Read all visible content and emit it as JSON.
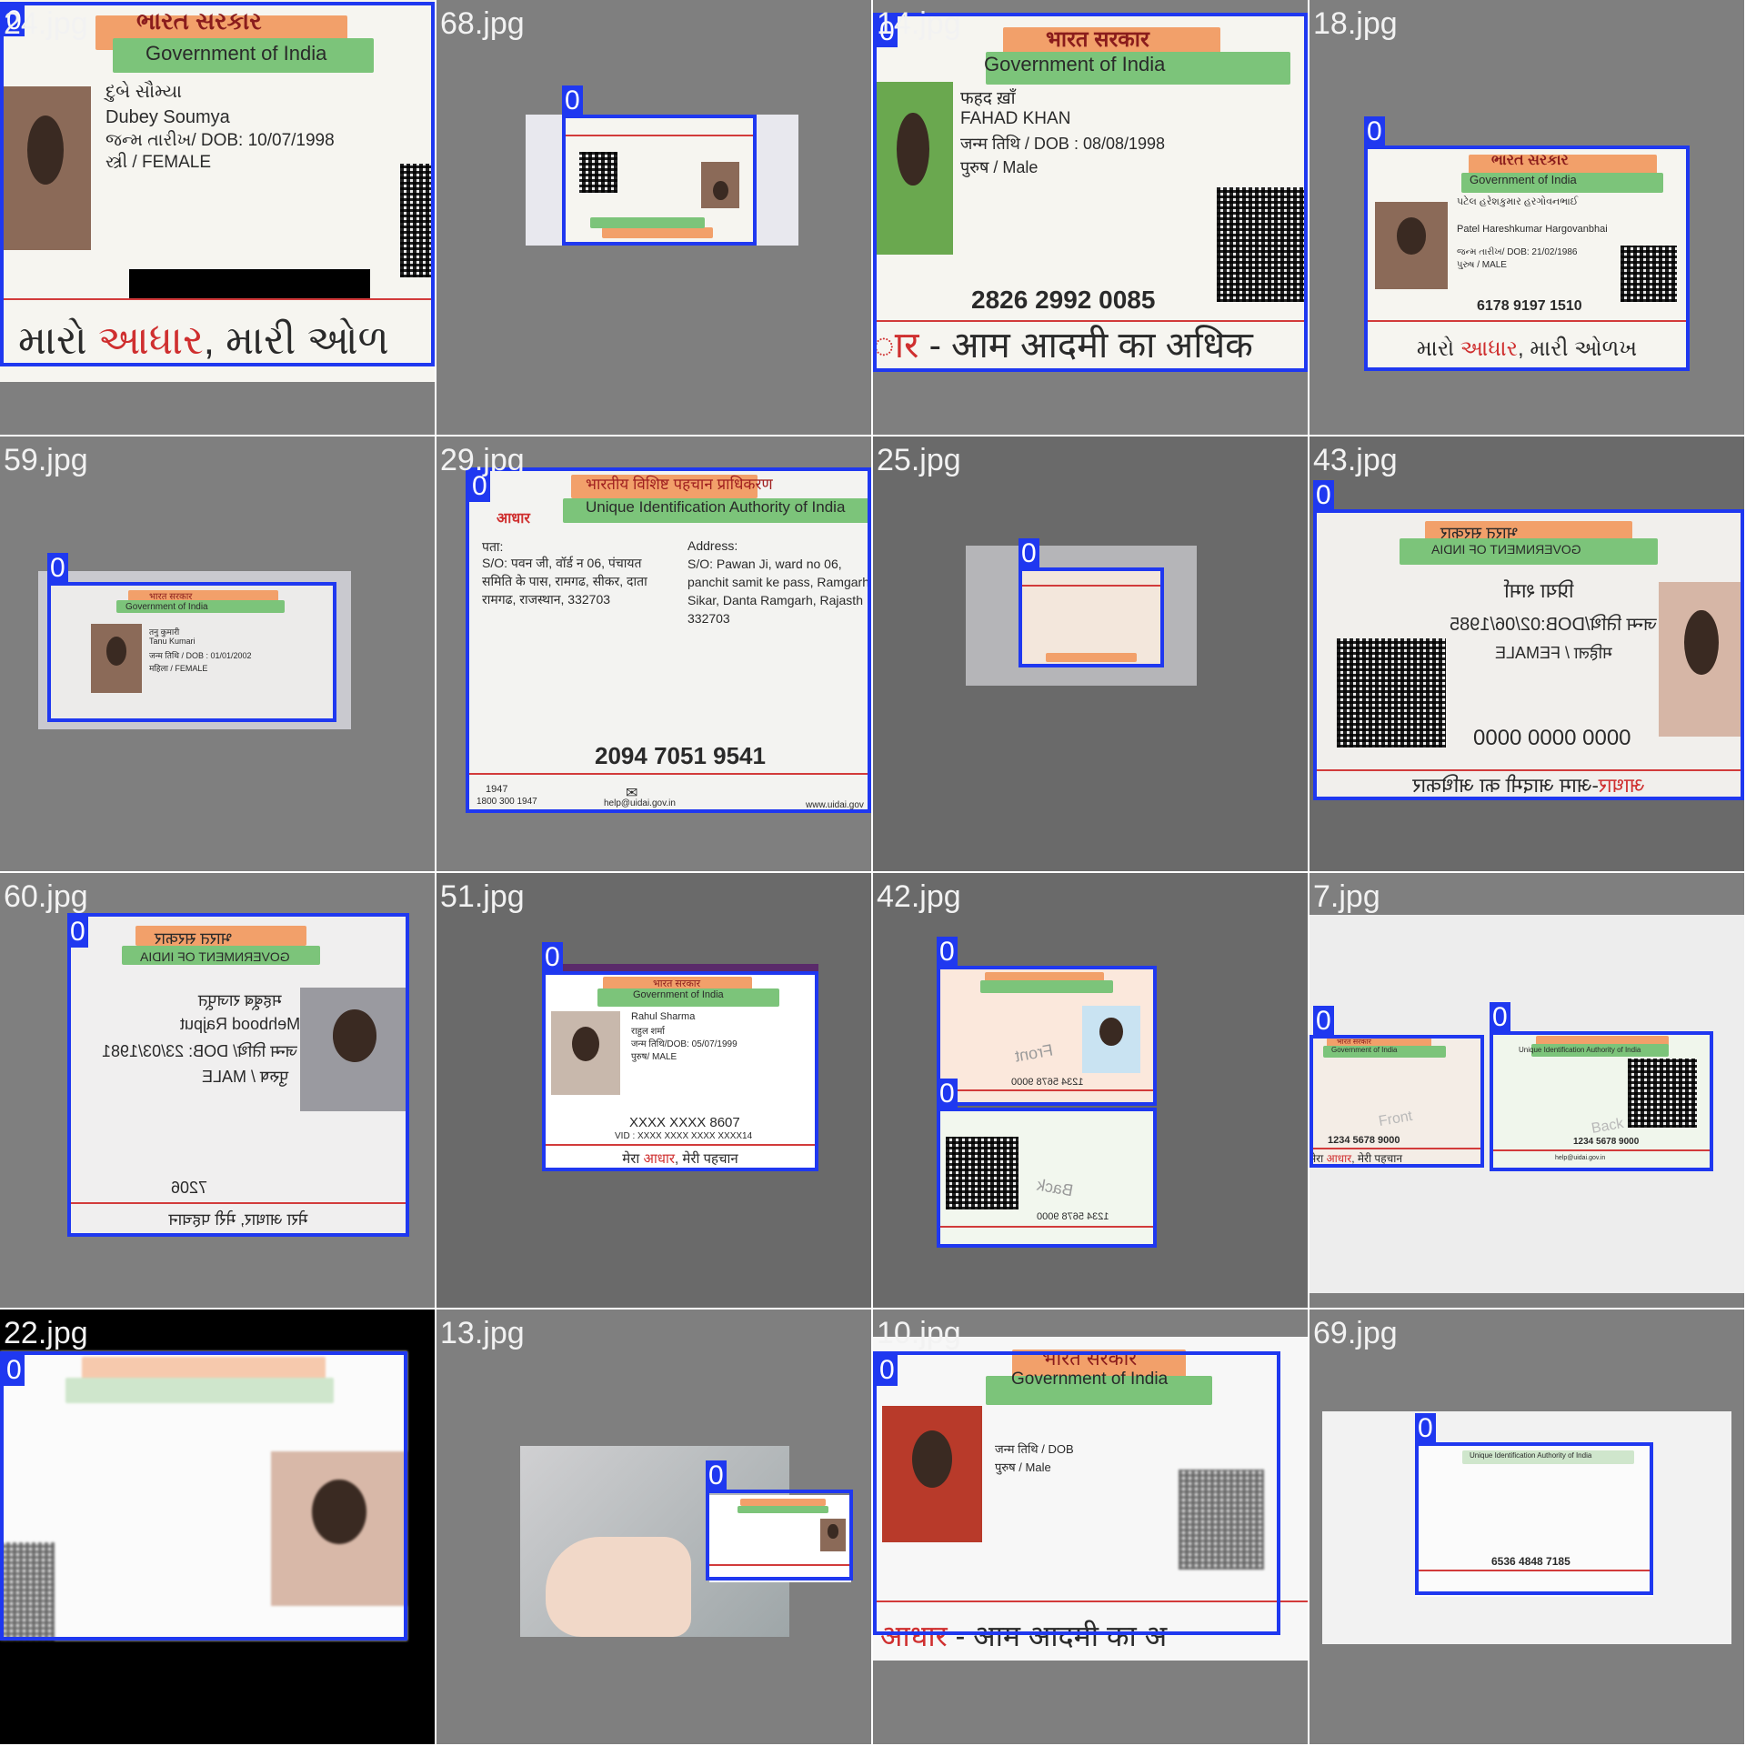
{
  "box_color": "#1f38f0",
  "class_label": "0",
  "tiles": [
    {
      "file": "24.jpg",
      "card": {
        "header_hi": "ભારત સરકાર",
        "header_en": "Government of India",
        "name_local": "દુબે સૌમ્યા",
        "name_en": "Dubey Soumya",
        "dob": "જન્મ તારીખ/ DOB: 10/07/1998",
        "gender": "સ્ત્રી / FEMALE",
        "bottom_a": "મારો ",
        "bottom_red": "આધાર",
        "bottom_b": ", મારી ઓળ"
      }
    },
    {
      "file": "68.jpg"
    },
    {
      "file": "14.jpg",
      "card": {
        "header_hi": "भारत सरकार",
        "header_en": "Government of India",
        "name_local": "फहद ख़ाँ",
        "name_en": "FAHAD KHAN",
        "dob": "जन्म तिथि / DOB : 08/08/1998",
        "gender": "पुरुष / Male",
        "number": "2826 2992 0085",
        "bottom_red": "ार",
        "bottom_b": " - आम आदमी का अधिक"
      }
    },
    {
      "file": "18.jpg",
      "card": {
        "header_hi": "ભારત સરકાર",
        "header_en": "Government of India",
        "name_local": "પટેલ હરેશકુમાર હરગોવનભાઈ",
        "name_en": "Patel Hareshkumar Hargovanbhai",
        "dob": "જન્મ તારીખ/ DOB: 21/02/1986",
        "gender": "પુરુષ / MALE",
        "number": "6178 9197 1510",
        "bottom_a": "મારો ",
        "bottom_red": "આધાર",
        "bottom_b": ", મારી ઓળખ"
      }
    },
    {
      "file": "59.jpg",
      "card": {
        "header_hi": "भारत सरकार",
        "header_en": "Government of India",
        "name_local": "तनु कुमारी",
        "name_en": "Tanu Kumari",
        "dob": "जन्म तिथि / DOB : 01/01/2002",
        "gender": "महिला / FEMALE"
      }
    },
    {
      "file": "29.jpg",
      "card": {
        "header_hi": "भारतीय विशिष्ट पहचान प्राधिकरण",
        "header_en": "Unique Identification Authority of India",
        "logo": "आधार",
        "addr_label_hi": "पता:",
        "addr_hi_1": "S/O: पवन जी, वॉर्ड न 06, पंचायत",
        "addr_hi_2": "समिति के पास, रामगढ, सीकर, दाता",
        "addr_hi_3": "रामगढ, राजस्थान, 332703",
        "addr_label_en": "Address:",
        "addr_en_1": "S/O: Pawan Ji, ward no 06,",
        "addr_en_2": "panchit samit ke pass, Ramgarh",
        "addr_en_3": "Sikar, Danta Ramgarh, Rajasth",
        "addr_en_4": "332703",
        "number": "2094 7051 9541",
        "f1a": "1947",
        "f1b": "1800 300 1947",
        "f2": "help@uidai.gov.in",
        "f3": "www.uidai.gov"
      }
    },
    {
      "file": "25.jpg"
    },
    {
      "file": "43.jpg",
      "card": {
        "header_hi": "भारत सरकार",
        "header_en": "GOVERNMENT OF INDIA",
        "name_local": "प्रिया शर्मा",
        "dob": "जन्म तिथि/DOB:02/06/1985",
        "gender": "महिला / FEMALE",
        "number": "0000 0000 0000",
        "bottom_red": "आधार",
        "bottom_b": "-आम आदमी का अधिकार"
      }
    },
    {
      "file": "60.jpg",
      "card": {
        "header_hi": "भारत सरकार",
        "header_en": "GOVERNMENT OF INDIA",
        "name_local": "महबूब राजपूत",
        "name_en": "Mehbood Rajput",
        "dob": "जन्म तिथि/ DOB: 23/03/1981",
        "gender": "पुरुष / MALE",
        "number": "7206",
        "bottom_b": "मेरा आधार, मेरी पहचान"
      }
    },
    {
      "file": "51.jpg",
      "card": {
        "header_hi": "भारत सरकार",
        "header_en": "Government of India",
        "name_en": "Rahul Sharma",
        "name_local": "राहुल शर्मा",
        "dob": "जन्म तिथि/DOB: 05/07/1999",
        "gender": "पुरुष/ MALE",
        "number": "XXXX XXXX 8607",
        "vid": "VID : XXXX XXXX XXXX XXXX14",
        "bottom_a": "मेरा ",
        "bottom_red": "आधार",
        "bottom_b": ", मेरी पहचान"
      }
    },
    {
      "file": "42.jpg",
      "front": {
        "watermark": "Front",
        "number": "1234 5678 9000"
      },
      "back": {
        "watermark": "Back",
        "number": "1234 5678 9000"
      }
    },
    {
      "file": "7.jpg",
      "front": {
        "header_hi": "भारत सरकार",
        "header_en": "Government of India",
        "watermark": "Front",
        "number": "1234 5678 9000",
        "bottom_a": "मेरा ",
        "bottom_red": "आधार",
        "bottom_b": ", मेरी पहचान"
      },
      "back": {
        "header_en": "Unique Identification Authority of India",
        "watermark": "Back",
        "number": "1234 5678 9000",
        "footer": "help@uidai.gov.in"
      }
    },
    {
      "file": "22.jpg"
    },
    {
      "file": "13.jpg"
    },
    {
      "file": "10.jpg",
      "card": {
        "header_hi": "भारत सरकार",
        "header_en": "Government of India",
        "dob": "जन्म तिथि / DOB",
        "gender": "पुरुष / Male",
        "bottom_red": "आधार",
        "bottom_b": " - आम आदमी का अ"
      }
    },
    {
      "file": "69.jpg",
      "card": {
        "header_en": "Unique Identification Authority of India",
        "number": "6536 4848 7185"
      }
    }
  ]
}
